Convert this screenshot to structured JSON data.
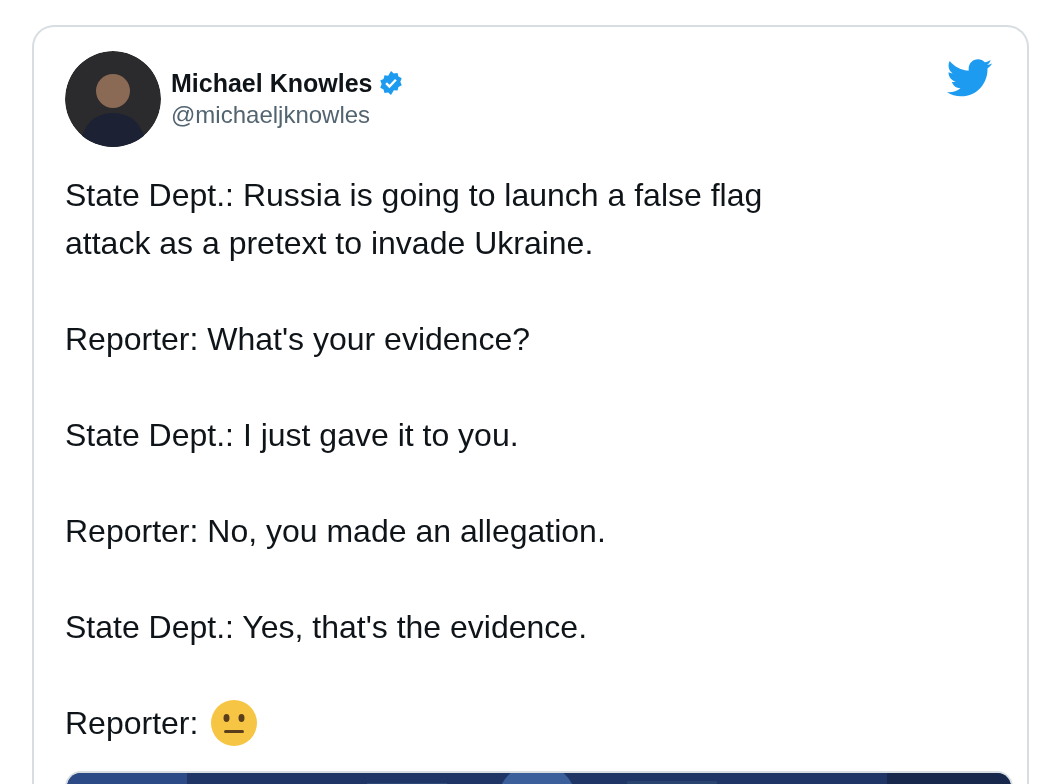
{
  "tweet": {
    "author": {
      "name": "Michael Knowles",
      "handle": "@michaeljknowles",
      "verified": true
    },
    "paragraphs": [
      {
        "kind": "text",
        "text": "State Dept.: Russia is going to launch a false flag attack as a pretext to invade Ukraine."
      },
      {
        "kind": "text",
        "text": "Reporter: What's your evidence?"
      },
      {
        "kind": "text",
        "text": "State Dept.: I just gave it to you."
      },
      {
        "kind": "text",
        "text": "Reporter: No, you made an allegation."
      },
      {
        "kind": "text",
        "text": "State Dept.: Yes, that's the evidence."
      },
      {
        "kind": "text_with_icon",
        "text": "Reporter:"
      }
    ]
  }
}
